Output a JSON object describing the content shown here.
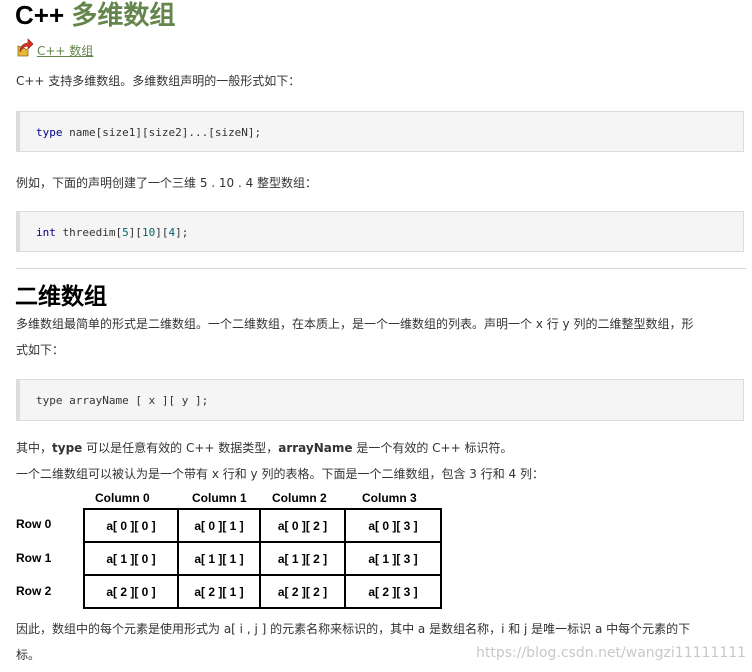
{
  "title": {
    "prefix": "C++ ",
    "highlight": "多维数组"
  },
  "back_link": {
    "label": "C++ 数组"
  },
  "intro": "C++ 支持多维数组。多维数组声明的一般形式如下：",
  "code1": {
    "kw": "type",
    "rest": " name[size1][size2]...[sizeN];"
  },
  "example_text": "例如，下面的声明创建了一个三维 5 . 10 . 4 整型数组：",
  "code2": {
    "kw": "int",
    "name": " threedim[",
    "n1": "5",
    "s1": "][",
    "n2": "10",
    "s2": "][",
    "n3": "4",
    "end": "];"
  },
  "section": {
    "title": "二维数组",
    "desc_line1": "多维数组最简单的形式是二维数组。一个二维数组，在本质上，是一个一维数组的列表。声明一个 x 行 y 列的二维整型数组，形",
    "desc_line2": "式如下：",
    "code3": "type arrayName [ x ][ y ];",
    "where": {
      "p1": "其中，",
      "b1": "type",
      "p2": " 可以是任意有效的 C++ 数据类型，",
      "b2": "arrayName",
      "p3": " 是一个有效的 C++ 标识符。"
    },
    "table_intro": "一个二维数组可以被认为是一个带有 x 行和 y 列的表格。下面是一个二维数组，包含 3 行和 4 列：",
    "columns": [
      "Column  0",
      "Column  1",
      "Column  2",
      "Column  3"
    ],
    "rows": [
      "Row  0",
      "Row  1",
      "Row  2"
    ],
    "cells": [
      [
        "a[ 0 ][ 0 ]",
        "a[ 0 ][ 1 ]",
        "a[ 0 ][ 2 ]",
        "a[ 0 ][ 3 ]"
      ],
      [
        "a[ 1 ][ 0 ]",
        "a[ 1 ][ 1 ]",
        "a[ 1 ][ 2 ]",
        "a[ 1 ][ 3 ]"
      ],
      [
        "a[ 2 ][ 0 ]",
        "a[ 2 ][ 1 ]",
        "a[ 2 ][ 2 ]",
        "a[ 2 ][ 3 ]"
      ]
    ],
    "conclusion_line1": "因此，数组中的每个元素是使用形式为 a[ i , j ] 的元素名称来标识的，其中 a 是数组名称，i 和 j 是唯一标识 a 中每个元素的下",
    "conclusion_line2": "标。"
  },
  "watermark": "https://blog.csdn.net/wangzi11111111",
  "colors": {
    "accent": "#64854c",
    "code_bg": "#f5f5f5",
    "keyword": "#000088",
    "number": "#006666"
  },
  "icons": {
    "back": "back-arrow-icon"
  }
}
